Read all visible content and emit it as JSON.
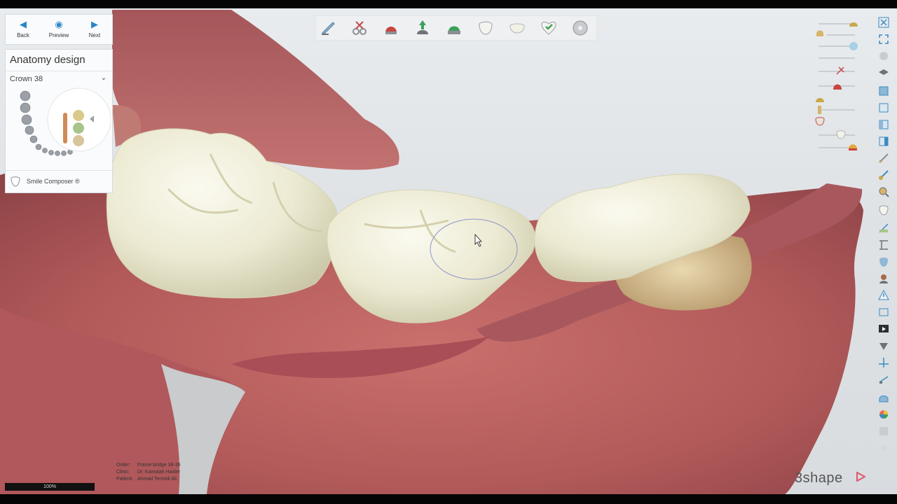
{
  "nav": {
    "back_label": "Back",
    "preview_label": "Preview",
    "next_label": "Next"
  },
  "panel": {
    "title": "Anatomy design",
    "crown_selector": "Crown 38",
    "smile_composer_label": "Smile Composer ®"
  },
  "toolbar": {
    "tools": [
      "knife-icon",
      "scissors-icon",
      "crown-red-icon",
      "insertion-direction-icon",
      "crown-green-icon",
      "tooth-icon",
      "tooth-flat-icon",
      "heart-check-icon",
      "cd-icon"
    ]
  },
  "info": {
    "order_label": "Order:",
    "order_value": "Frame bridge 38-36",
    "clinic_label": "Clinic:",
    "clinic_value": "Dr. Kamalah Haider",
    "patient_label": "Patient:",
    "patient_value": "Ahmad Termidi Ali"
  },
  "zoom_text": "100%",
  "brand": "3shape",
  "colors": {
    "accent": "#2a86c8",
    "gum": "#b9605e",
    "tooth": "#efedd6",
    "brand": "#e0556a"
  }
}
